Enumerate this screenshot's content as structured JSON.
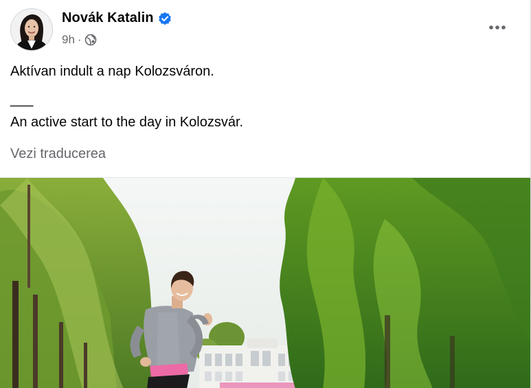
{
  "post": {
    "author": "Novák Katalin",
    "timestamp": "9h",
    "separator": "·",
    "audience_icon": "globe-icon",
    "verified_icon": "verified-badge-icon",
    "more_icon": "more-options-icon",
    "text_line_1": "Aktívan indult a nap Kolozsváron.",
    "text_separator": "___",
    "text_line_2": "An active start to the day in Kolozsvár.",
    "see_translation": "Vezi traducerea"
  },
  "colors": {
    "verified_blue": "#1877f2",
    "secondary_text": "#65676b",
    "primary_text": "#050505"
  }
}
